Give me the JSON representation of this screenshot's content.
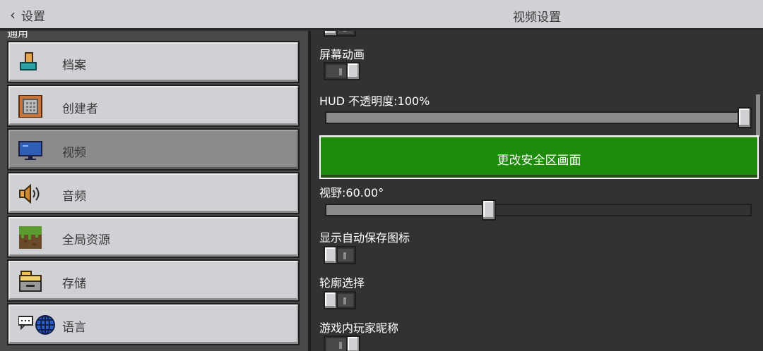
{
  "header": {
    "back_label": "设置",
    "title": "视频设置"
  },
  "sidebar": {
    "section_label": "通用",
    "items": [
      {
        "label": "档案",
        "icon": "profile-icon"
      },
      {
        "label": "创建者",
        "icon": "creator-icon"
      },
      {
        "label": "视频",
        "icon": "monitor-icon",
        "active": true
      },
      {
        "label": "音频",
        "icon": "speaker-icon"
      },
      {
        "label": "全局资源",
        "icon": "grass-block-icon"
      },
      {
        "label": "存储",
        "icon": "storage-icon"
      },
      {
        "label": "语言",
        "icon": "language-icon"
      }
    ]
  },
  "settings": {
    "screen_animation_label": "屏幕动画",
    "hud_opacity_label": "HUD 不透明度:100%",
    "hud_opacity_value": 1.0,
    "safe_zone_button": "更改安全区画面",
    "fov_label": "视野:60.00°",
    "fov_value": 0.38,
    "autosave_icon_label": "显示自动保存图标",
    "outline_selection_label": "轮廓选择",
    "ingame_nametags_label": "游戏内玩家昵称"
  },
  "colors": {
    "accent_green": "#1e8a0a",
    "panel_light": "#d0d1d4",
    "panel_dark": "#313233"
  }
}
